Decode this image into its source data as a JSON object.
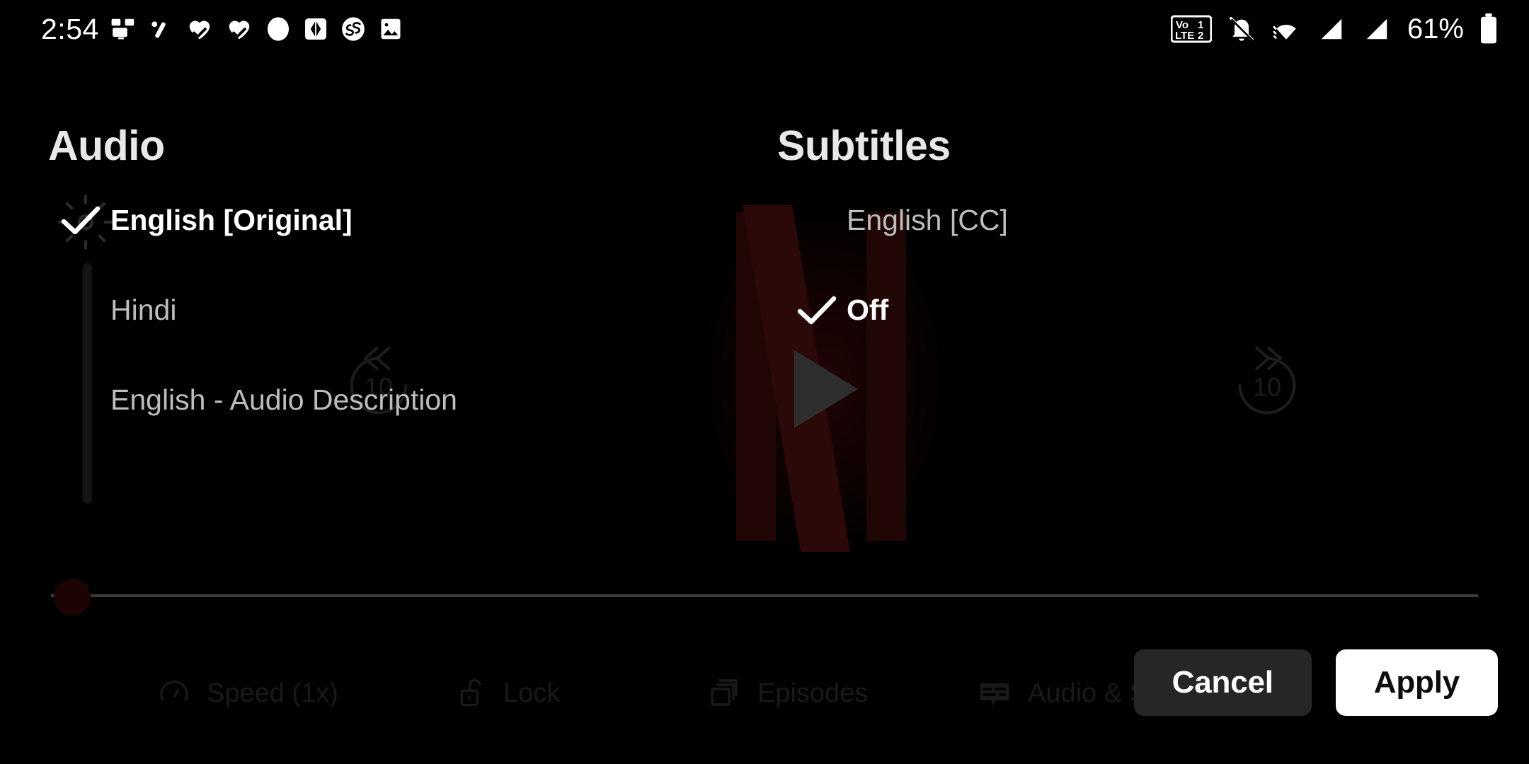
{
  "statusbar": {
    "time": "2:54",
    "battery_percent": "61%",
    "left_icons": [
      {
        "name": "screen-cast-icon"
      },
      {
        "name": "pen-draw-icon"
      },
      {
        "name": "heart-check-icon"
      },
      {
        "name": "heart-check-icon-2"
      },
      {
        "name": "circle-dot-icon"
      },
      {
        "name": "diamond-square-icon"
      },
      {
        "name": "infinity-circle-icon"
      },
      {
        "name": "photo-icon"
      }
    ],
    "right_icons": [
      {
        "name": "volte-dual-sim-icon",
        "label_top": "Vo",
        "label_bottom": "LTE",
        "sim1": "1",
        "sim2": "2"
      },
      {
        "name": "notifications-muted-icon"
      },
      {
        "name": "wifi-icon"
      },
      {
        "name": "signal-sim1-icon"
      },
      {
        "name": "signal-sim2-icon"
      },
      {
        "name": "battery-icon"
      }
    ]
  },
  "overlay": {
    "audio": {
      "title": "Audio",
      "options": [
        {
          "label": "English [Original]",
          "selected": true
        },
        {
          "label": "Hindi",
          "selected": false
        },
        {
          "label": "English - Audio Description",
          "selected": false
        }
      ]
    },
    "subtitles": {
      "title": "Subtitles",
      "options": [
        {
          "label": "English [CC]",
          "selected": false
        },
        {
          "label": "Off",
          "selected": true
        }
      ]
    }
  },
  "footer": {
    "cancel_label": "Cancel",
    "apply_label": "Apply"
  },
  "player": {
    "skip_back_label": "10",
    "skip_forward_label": "10",
    "bottom_bar": [
      {
        "label": "Speed (1x)",
        "icon": "speedometer-icon"
      },
      {
        "label": "Lock",
        "icon": "lock-open-icon"
      },
      {
        "label": "Episodes",
        "icon": "episodes-icon"
      },
      {
        "label": "Audio & Subtitles",
        "icon": "subtitles-icon"
      }
    ]
  },
  "colors": {
    "background": "#000000",
    "accent_white": "#ffffff",
    "muted_text": "#bdbdbd",
    "cancel_bg": "#262626",
    "netflix_red_dim": "#2c0909"
  }
}
